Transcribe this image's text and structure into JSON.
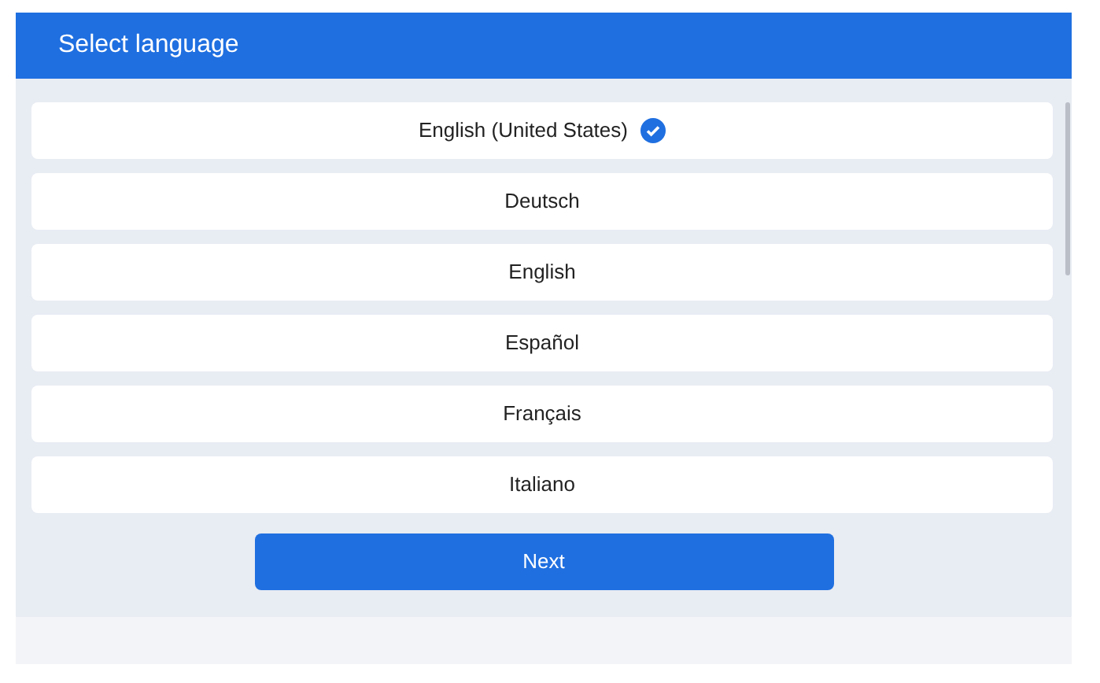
{
  "header": {
    "title": "Select language"
  },
  "languages": [
    {
      "label": "English (United States)",
      "selected": true
    },
    {
      "label": "Deutsch",
      "selected": false
    },
    {
      "label": "English",
      "selected": false
    },
    {
      "label": "Español",
      "selected": false
    },
    {
      "label": "Français",
      "selected": false
    },
    {
      "label": "Italiano",
      "selected": false
    }
  ],
  "next_button": {
    "label": "Next"
  }
}
